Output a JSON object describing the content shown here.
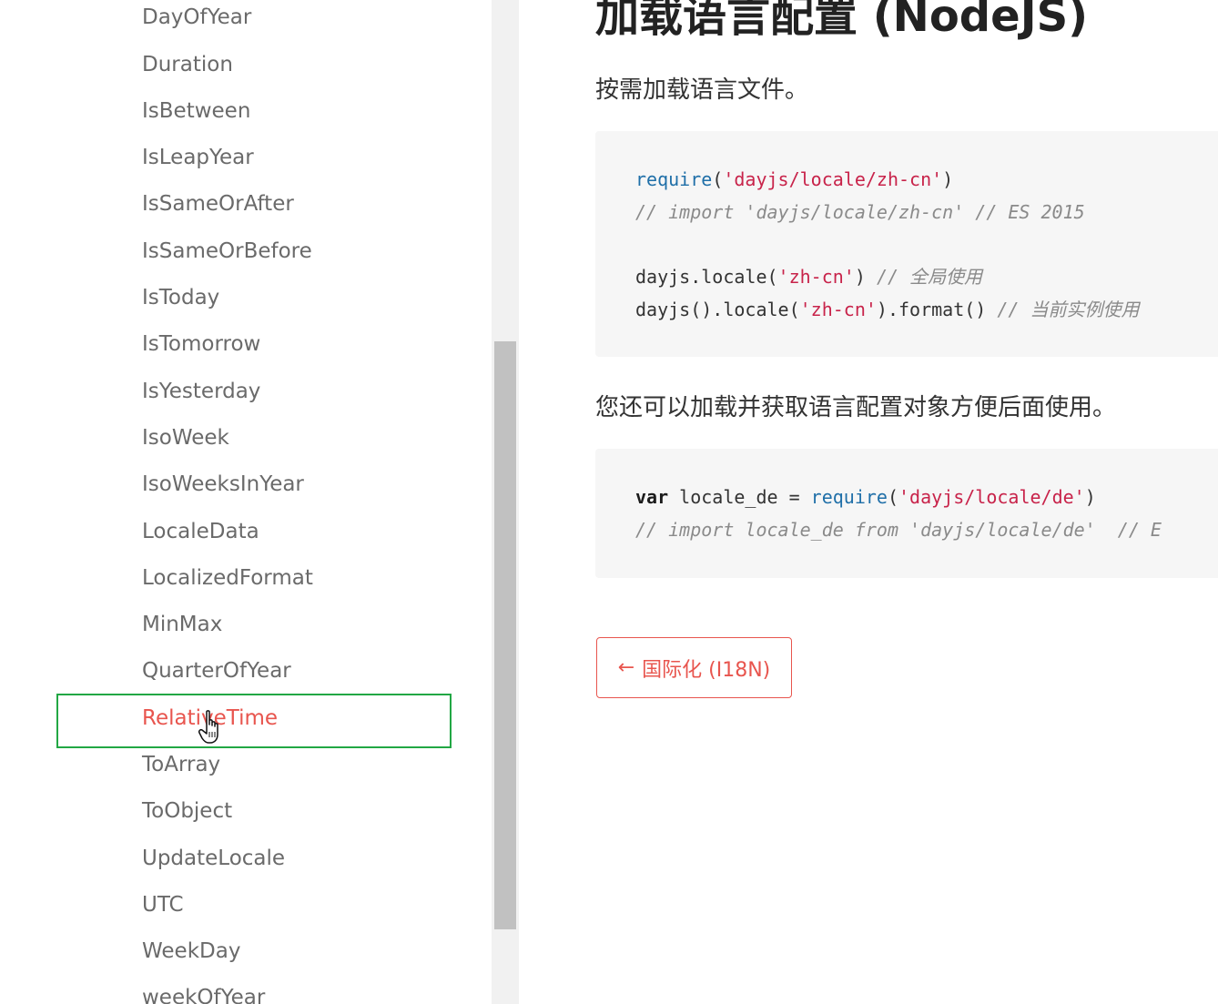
{
  "sidebar": {
    "items": [
      {
        "label": "DayOfYear"
      },
      {
        "label": "Duration"
      },
      {
        "label": "IsBetween"
      },
      {
        "label": "IsLeapYear"
      },
      {
        "label": "IsSameOrAfter"
      },
      {
        "label": "IsSameOrBefore"
      },
      {
        "label": "IsToday"
      },
      {
        "label": "IsTomorrow"
      },
      {
        "label": "IsYesterday"
      },
      {
        "label": "IsoWeek"
      },
      {
        "label": "IsoWeeksInYear"
      },
      {
        "label": "LocaleData"
      },
      {
        "label": "LocalizedFormat"
      },
      {
        "label": "MinMax"
      },
      {
        "label": "QuarterOfYear"
      },
      {
        "label": "RelativeTime"
      },
      {
        "label": "ToArray"
      },
      {
        "label": "ToObject"
      },
      {
        "label": "UpdateLocale"
      },
      {
        "label": "UTC"
      },
      {
        "label": "WeekDay"
      },
      {
        "label": "weekOfYear"
      }
    ],
    "active_item": "RelativeTime"
  },
  "main": {
    "title": "加载语言配置 (NodeJS)",
    "para1": "按需加载语言文件。",
    "code1": {
      "l1_fn": "require",
      "l1_open": "(",
      "l1_str": "'dayjs/locale/zh-cn'",
      "l1_close": ")",
      "l2_comment": "// import 'dayjs/locale/zh-cn' // ES 2015",
      "l3_pre": "dayjs.locale(",
      "l3_str": "'zh-cn'",
      "l3_post": ") ",
      "l3_comment": "// 全局使用",
      "l4_pre": "dayjs().locale(",
      "l4_str": "'zh-cn'",
      "l4_post": ").format() ",
      "l4_comment": "// 当前实例使用"
    },
    "para2": "您还可以加载并获取语言配置对象方便后面使用。",
    "code2": {
      "l1_kw": "var",
      "l1_mid": " locale_de = ",
      "l1_fn": "require",
      "l1_open": "(",
      "l1_str": "'dayjs/locale/de'",
      "l1_close": ")",
      "l2_comment": "// import locale_de from 'dayjs/locale/de'  // E"
    },
    "prev_button": {
      "arrow": "←",
      "label": "国际化 (I18N)"
    }
  },
  "colors": {
    "accent": "#e8554e",
    "highlight_border": "#22a744",
    "string": "#c8234a",
    "function": "#1f6fa8"
  }
}
